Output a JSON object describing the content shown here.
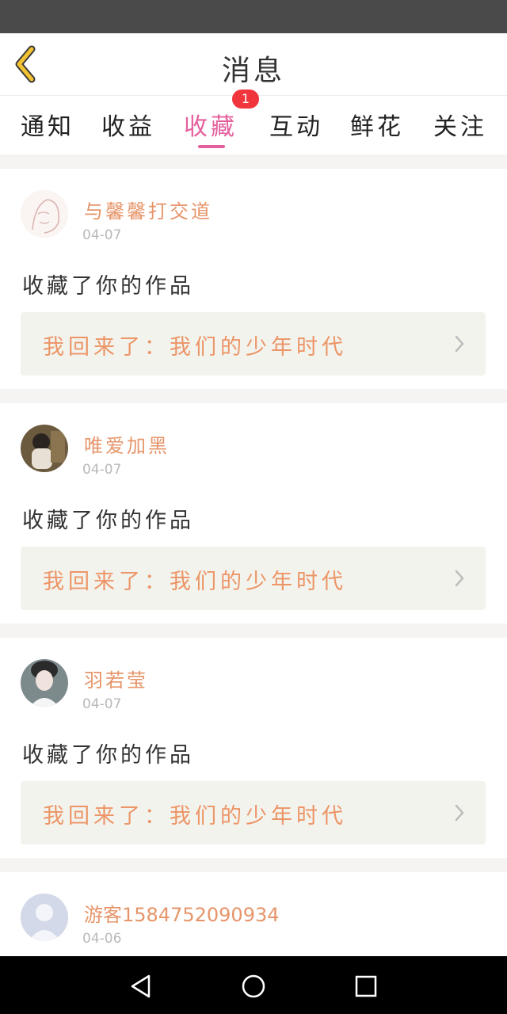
{
  "header": {
    "title": "消息"
  },
  "tabs": [
    {
      "label": "通知"
    },
    {
      "label": "收益"
    },
    {
      "label": "收藏"
    },
    {
      "label": "互动"
    },
    {
      "label": "鲜花"
    },
    {
      "label": "关注"
    }
  ],
  "active_tab": "收藏",
  "badge": {
    "count": "1"
  },
  "messages": [
    {
      "username": "与馨馨打交道",
      "date": "04-07",
      "action": "收藏了你的作品",
      "work": "我回来了：我们的少年时代"
    },
    {
      "username": "唯爱加黑",
      "date": "04-07",
      "action": "收藏了你的作品",
      "work": "我回来了：我们的少年时代"
    },
    {
      "username": "羽若莹",
      "date": "04-07",
      "action": "收藏了你的作品",
      "work": "我回来了：我们的少年时代"
    },
    {
      "username": "游客15847520909​34",
      "date": "04-06"
    }
  ],
  "icons": {
    "back": "chevron-left-icon",
    "nav_back": "triangle-back-icon",
    "nav_home": "circle-home-icon",
    "nav_recent": "square-recent-icon"
  },
  "colors": {
    "accent": "#e4609d",
    "username": "#e6956a",
    "badge": "#f0353c",
    "back_arrow": "#f2c232"
  }
}
